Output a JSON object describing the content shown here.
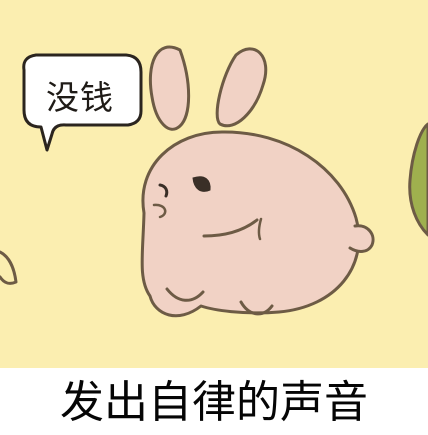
{
  "speech_bubble": {
    "text": "没钱"
  },
  "caption": {
    "text": "发出自律的声音"
  },
  "colors": {
    "background": "#fbeeb0",
    "caption_band": "#ffffff",
    "bunny_fill": "#f1d2c5",
    "line": "#6d5b45"
  }
}
